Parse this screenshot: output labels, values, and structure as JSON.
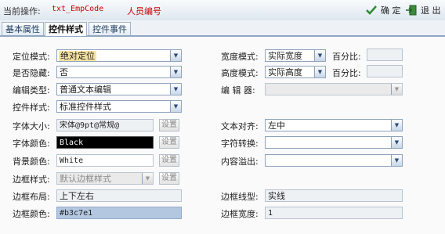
{
  "topbar": {
    "label": "当前操作:",
    "control_code": "txt_EmpCode",
    "control_name": "人员编号",
    "ok_label": "确 定",
    "exit_label": "退 出"
  },
  "tabs": [
    {
      "label": "基本属性"
    },
    {
      "label": "控件样式"
    },
    {
      "label": "控件事件"
    }
  ],
  "form": {
    "position_mode": {
      "label": "定位模式:",
      "value": "绝对定位"
    },
    "is_hidden": {
      "label": "是否隐藏:",
      "value": "否"
    },
    "edit_type": {
      "label": "编辑类型:",
      "value": "普通文本编辑"
    },
    "control_style": {
      "label": "控件样式:",
      "value": "标准控件样式"
    },
    "font_size": {
      "label": "字体大小:",
      "value": "宋体@9pt@常规@",
      "button": "设置"
    },
    "font_color": {
      "label": "字体颜色:",
      "value": "Black",
      "button": "设置"
    },
    "bg_color": {
      "label": "背景颜色:",
      "value": "White",
      "button": "设置"
    },
    "border_style": {
      "label": "边框样式:",
      "value": "默认边框样式",
      "button": "设置"
    },
    "border_layout": {
      "label": "边框布局:",
      "value": "上下左右"
    },
    "border_color": {
      "label": "边框颜色:",
      "value": "#b3c7e1"
    },
    "width_mode": {
      "label": "宽度模式:",
      "value": "实际宽度",
      "percent_label": "百分比:",
      "percent_value": ""
    },
    "height_mode": {
      "label": "高度模式:",
      "value": "实际高度",
      "percent_label": "百分比:",
      "percent_value": ""
    },
    "editor": {
      "label": "编 辑 器:",
      "value": ""
    },
    "text_align": {
      "label": "文本对齐:",
      "value": "左中"
    },
    "char_convert": {
      "label": "字符转换:",
      "value": ""
    },
    "overflow": {
      "label": "内容溢出:",
      "value": ""
    },
    "border_line": {
      "label": "边框线型:",
      "value": "实线"
    },
    "border_width": {
      "label": "边框宽度:",
      "value": "1"
    }
  },
  "colors": {
    "accent": "#8fa7c3",
    "font_color_swatch": "#000000",
    "border_color_swatch": "#b3c7e1",
    "title_red": "#cc0000"
  }
}
